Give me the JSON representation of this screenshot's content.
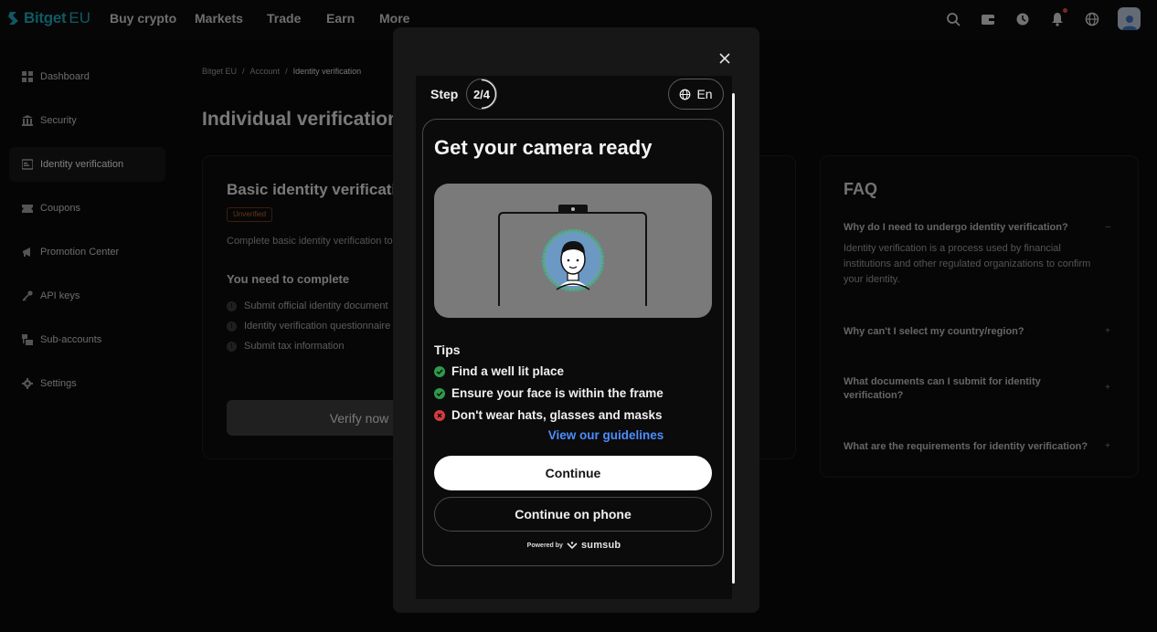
{
  "brand": {
    "name": "Bitget",
    "suffix": "EU",
    "accent": "#1da2b4"
  },
  "topnav": {
    "items": [
      "Buy crypto",
      "Markets",
      "Trade",
      "Earn",
      "More"
    ],
    "icons": [
      "search-icon",
      "wallet-icon",
      "orders-icon",
      "notifications-icon",
      "globe-icon"
    ]
  },
  "sidebar": {
    "items": [
      {
        "label": "Dashboard",
        "icon": "dashboard-icon"
      },
      {
        "label": "Security",
        "icon": "bank-icon"
      },
      {
        "label": "Identity verification",
        "icon": "id-card-icon"
      },
      {
        "label": "Coupons",
        "icon": "coupon-icon"
      },
      {
        "label": "Promotion Center",
        "icon": "megaphone-icon"
      },
      {
        "label": "API keys",
        "icon": "key-icon"
      },
      {
        "label": "Sub-accounts",
        "icon": "sub-accounts-icon"
      },
      {
        "label": "Settings",
        "icon": "gear-icon"
      }
    ],
    "active_index": 2
  },
  "breadcrumb": {
    "items": [
      "Bitget EU",
      "Account",
      "Identity verification"
    ]
  },
  "page": {
    "title": "Individual verification"
  },
  "basic_card": {
    "title": "Basic identity verification",
    "status": "Unverified",
    "description": "Complete basic identity verification to",
    "need_title": "You need to complete",
    "requirements": [
      "Submit official identity document",
      "Identity verification questionnaire",
      "Submit tax information"
    ],
    "verify_button": "Verify now"
  },
  "faq": {
    "title": "FAQ",
    "items": [
      {
        "q": "Why do I need to undergo identity verification?",
        "a": "Identity verification is a process used by financial institutions and other regulated organizations to confirm your identity.",
        "toggle": "–"
      },
      {
        "q": "Why can't I select my country/region?",
        "toggle": "+"
      },
      {
        "q": "What documents can I submit for identity verification?",
        "toggle": "+"
      },
      {
        "q": "What are the requirements for identity verification?",
        "toggle": "+"
      }
    ]
  },
  "modal": {
    "step_label": "Step",
    "step_value": "2/4",
    "language": "En",
    "title": "Get your camera ready",
    "tips_title": "Tips",
    "tips": [
      {
        "text": "Find a well lit place",
        "ok": true
      },
      {
        "text": "Ensure your face is within the frame",
        "ok": true
      },
      {
        "text": "Don't wear hats, glasses and masks",
        "ok": false
      }
    ],
    "guidelines_link": "View our guidelines",
    "continue_button": "Continue",
    "continue_phone_button": "Continue on phone",
    "powered_by": "Powered by",
    "provider": "sumsub"
  },
  "colors": {
    "link": "#4c8dff",
    "ok": "#2f9a4a",
    "error": "#d43c3c",
    "badge": "#b9652a"
  }
}
